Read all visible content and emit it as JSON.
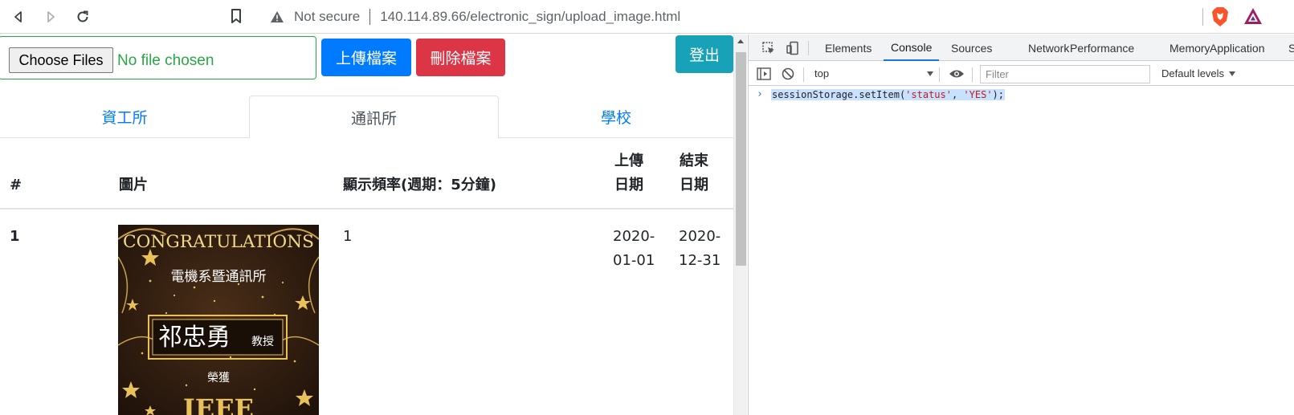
{
  "browser": {
    "security_label": "Not secure",
    "url": "140.114.89.66/electronic_sign/upload_image.html"
  },
  "page": {
    "file_input": {
      "button_label": "Choose Files",
      "status": "No file chosen"
    },
    "upload_label": "上傳檔案",
    "delete_label": "刪除檔案",
    "logout_label": "登出",
    "tabs": [
      {
        "label": "資工所",
        "active": false
      },
      {
        "label": "通訊所",
        "active": true
      },
      {
        "label": "學校",
        "active": false
      }
    ],
    "table": {
      "headers": {
        "index": "#",
        "image": "圖片",
        "frequency": "顯示頻率(週期：5分鐘)",
        "upload_date": [
          "上傳",
          "日期"
        ],
        "end_date": [
          "結束",
          "日期"
        ]
      },
      "rows": [
        {
          "index": "1",
          "frequency": "1",
          "upload_date": [
            "2020-",
            "01-01"
          ],
          "end_date": [
            "2020-",
            "12-31"
          ],
          "poster": {
            "headline": "CONGRATULATIONS",
            "department": "電機系暨通訊所",
            "name": "祁忠勇",
            "title": "教授",
            "award": "榮獲",
            "award_text": "IEEE"
          }
        }
      ]
    }
  },
  "devtools": {
    "tabs": [
      {
        "label": "Elements",
        "active": false
      },
      {
        "label": "Console",
        "active": true
      },
      {
        "label": "Sources",
        "active": false
      },
      {
        "label": "Network",
        "active": false
      },
      {
        "label": "Performance",
        "active": false
      },
      {
        "label": "Memory",
        "active": false
      },
      {
        "label": "Application",
        "active": false
      },
      {
        "label": "S",
        "active": false
      }
    ],
    "context": "top",
    "filter_placeholder": "Filter",
    "levels": "Default levels",
    "console_input": {
      "prefix": "sessionStorage.setItem(",
      "arg1": "'status'",
      "comma": ", ",
      "arg2": "'YES'",
      "suffix": ");"
    }
  },
  "colors": {
    "primary": "#007bff",
    "danger": "#dc3545",
    "info": "#17a2b8",
    "success": "#28a745",
    "devtools_accent": "#1a73e8"
  }
}
